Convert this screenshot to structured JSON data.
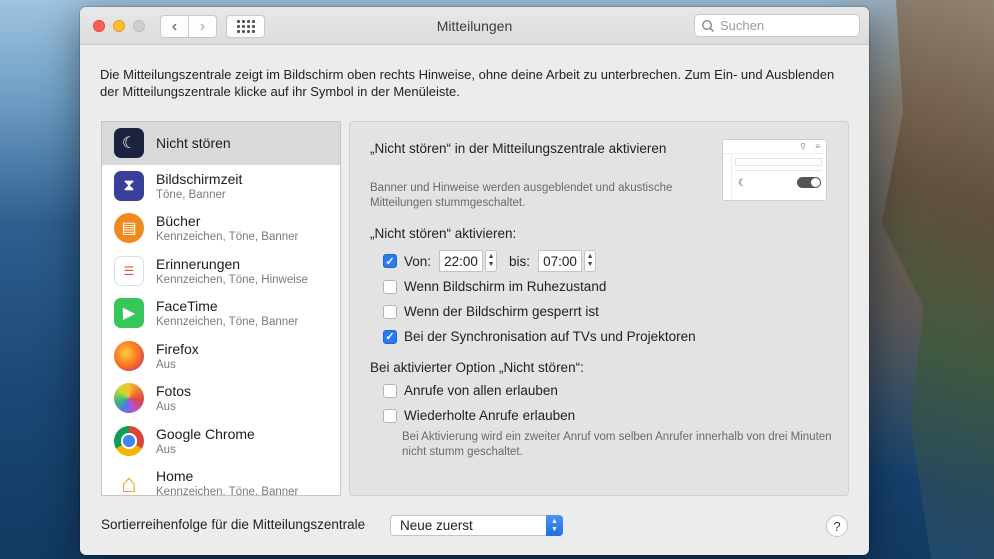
{
  "window": {
    "title": "Mitteilungen",
    "search_placeholder": "Suchen"
  },
  "intro": "Die Mitteilungszentrale zeigt im Bildschirm oben rechts Hinweise, ohne deine Arbeit zu unterbrechen. Zum Ein- und Ausblenden der Mitteilungszentrale klicke auf ihr Symbol in der Menüleiste.",
  "apps": [
    {
      "name": "Nicht stören",
      "sub": "",
      "icon": "moon-icon",
      "selected": true
    },
    {
      "name": "Bildschirmzeit",
      "sub": "Töne, Banner",
      "icon": "hourglass-icon"
    },
    {
      "name": "Bücher",
      "sub": "Kennzeichen, Töne, Banner",
      "icon": "book-icon"
    },
    {
      "name": "Erinnerungen",
      "sub": "Kennzeichen, Töne, Hinweise",
      "icon": "reminders-icon"
    },
    {
      "name": "FaceTime",
      "sub": "Kennzeichen, Töne, Banner",
      "icon": "video-camera-icon"
    },
    {
      "name": "Firefox",
      "sub": "Aus",
      "icon": "firefox-icon"
    },
    {
      "name": "Fotos",
      "sub": "Aus",
      "icon": "photos-flower-icon"
    },
    {
      "name": "Google Chrome",
      "sub": "Aus",
      "icon": "chrome-icon"
    },
    {
      "name": "Home",
      "sub": "Kennzeichen, Töne, Banner",
      "icon": "house-icon"
    }
  ],
  "panel": {
    "heading": "„Nicht stören“ in der Mitteilungszentrale aktivieren",
    "note": "Banner und Hinweise werden ausgeblendet und akustische Mitteilungen stummgeschaltet.",
    "activate_label": "„Nicht stören“ aktivieren:",
    "from_label": "Von:",
    "from_time": "22:00",
    "to_label": "bis:",
    "to_time": "07:00",
    "options": [
      {
        "label": "Wenn Bildschirm im Ruhezustand",
        "checked": false
      },
      {
        "label": "Wenn der Bildschirm gesperrt ist",
        "checked": false
      },
      {
        "label": "Bei der Synchronisation auf TVs und Projektoren",
        "checked": true
      }
    ],
    "when_active_label": "Bei aktivierter Option „Nicht stören“:",
    "call_options": [
      {
        "label": "Anrufe von allen erlauben",
        "checked": false
      },
      {
        "label": "Wiederholte Anrufe erlauben",
        "checked": false
      }
    ],
    "footnote": "Bei Aktivierung wird ein zweiter Anruf vom selben Anrufer innerhalb von drei Minuten nicht stumm geschaltet."
  },
  "footer": {
    "sort_label": "Sortierreihenfolge für die Mitteilungszentrale",
    "sort_value": "Neue zuerst",
    "help": "?"
  },
  "colors": {
    "accent": "#2b7bf0",
    "close": "#fd5f57",
    "minimize": "#febc2e"
  }
}
